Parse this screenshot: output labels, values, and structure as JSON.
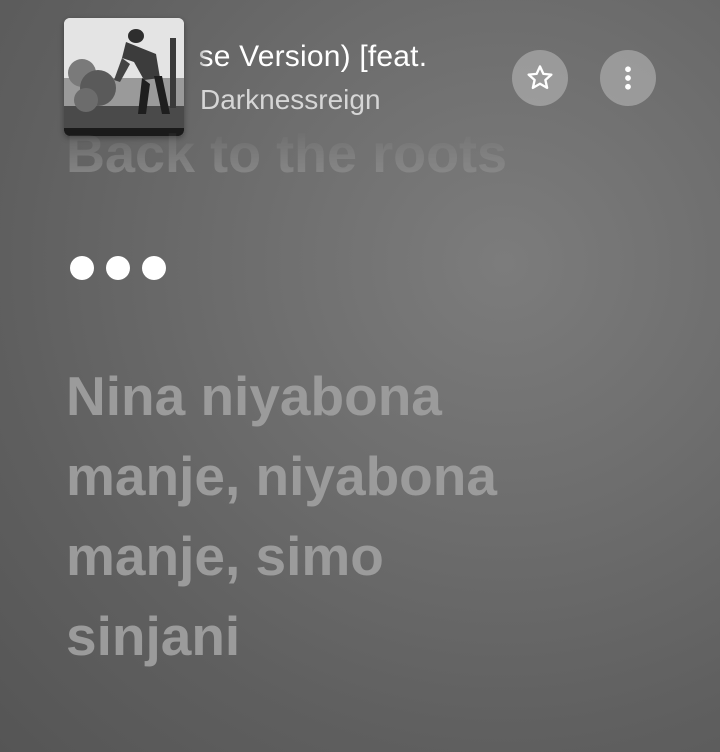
{
  "now_playing": {
    "title": "(Piano House Version) [feat. Nina]",
    "title_visible": "ıse Version) [feat.",
    "artist": "Darknessreign",
    "album_art": "album-cover-photo"
  },
  "controls": {
    "favorite_icon": "star-icon",
    "more_icon": "more-vertical-icon"
  },
  "lyrics": {
    "previous_line": "Back to the roots",
    "interlude": "•••",
    "next_lines": [
      "Nina niyabona",
      "manje, niyabona",
      "manje, simo",
      "sinjani"
    ]
  },
  "colors": {
    "background": "#6e6e6e",
    "primary_text": "#ffffff",
    "secondary_text": "#d6d6d6",
    "inactive_lyric": "#9b9b9b",
    "button_fill": "#bebebe"
  }
}
